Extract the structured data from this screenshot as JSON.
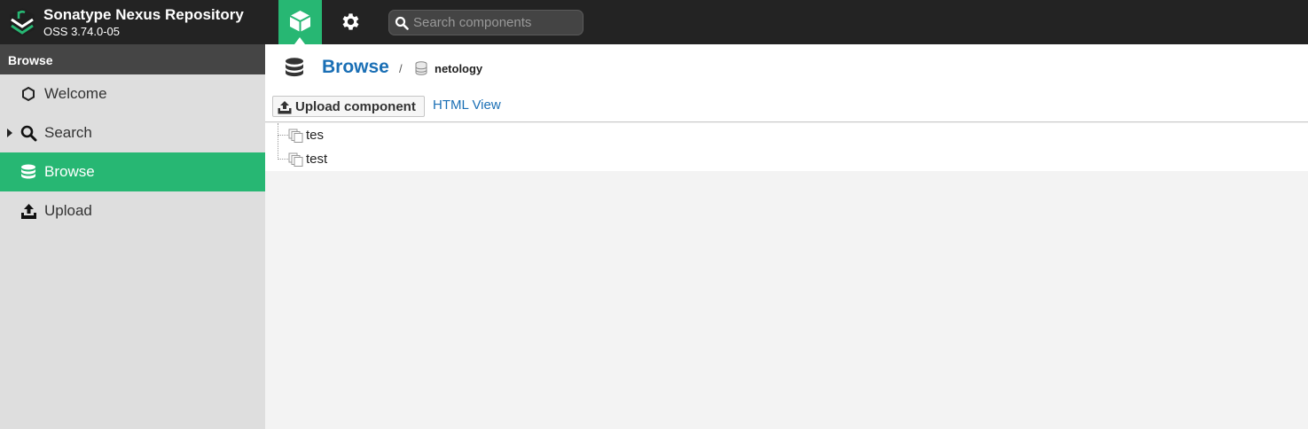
{
  "app": {
    "title": "Sonatype Nexus Repository",
    "version": "OSS 3.74.0-05"
  },
  "header": {
    "modes": [
      {
        "name": "browse",
        "icon": "cube-icon",
        "active": true
      },
      {
        "name": "administration",
        "icon": "gear-icon",
        "active": false
      }
    ],
    "search": {
      "placeholder": "Search components",
      "value": ""
    }
  },
  "sidebar": {
    "title": "Browse",
    "items": [
      {
        "label": "Welcome",
        "icon": "hexagon-icon",
        "active": false
      },
      {
        "label": "Search",
        "icon": "search-icon",
        "active": false,
        "expandable": true
      },
      {
        "label": "Browse",
        "icon": "database-icon",
        "active": true
      },
      {
        "label": "Upload",
        "icon": "upload-icon",
        "active": false
      }
    ]
  },
  "main": {
    "breadcrumb": {
      "title": "Browse",
      "separator": "/",
      "repository": "netology"
    },
    "toolbar": {
      "upload_label": "Upload component",
      "html_view_label": "HTML View"
    },
    "tree": [
      {
        "name": "tes",
        "icon": "folder-stack-icon"
      },
      {
        "name": "test",
        "icon": "folder-stack-icon"
      }
    ]
  },
  "colors": {
    "accent": "#27b773",
    "header_bg": "#232323",
    "link": "#1a6fb5",
    "sidebar_bg": "#dedede",
    "sidebar_title_bg": "#454545"
  }
}
